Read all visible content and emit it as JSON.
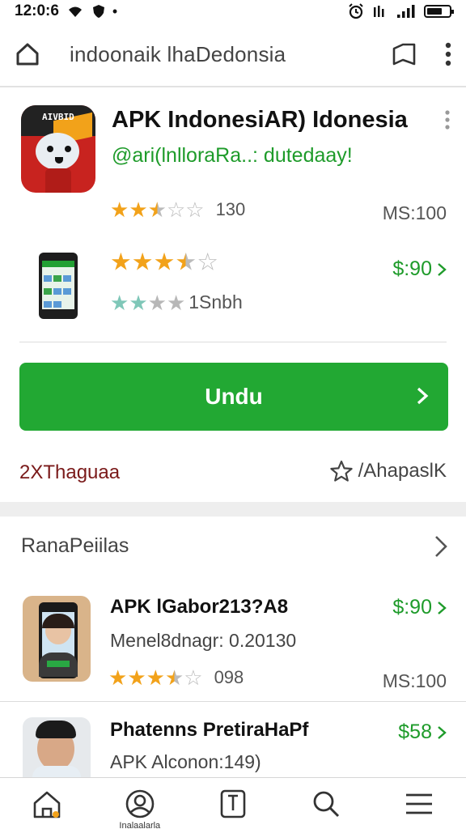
{
  "status_bar": {
    "time": "12:0:6",
    "dot": "•"
  },
  "browser": {
    "url": "indoonaik lhaDedonsia",
    "icons": [
      "home-icon",
      "share-icon",
      "more-vert-icon"
    ]
  },
  "app_card": {
    "title": "APK IndonesiAR) Idonesia",
    "subtitle": "@ari(lnlloraRa..: dutedaay!",
    "icon_cap_text": "AIVBID",
    "rating_1": {
      "rating": 2.5,
      "max": 5,
      "count": "130",
      "price": "MS:100"
    },
    "rating_2": {
      "rating": 3.5,
      "max": 5,
      "price": "$:90"
    },
    "rating_3": {
      "rating": 2,
      "max": 4,
      "count": "1Snbh"
    },
    "download_label": "Undu",
    "footer_left": "2XThaguaa",
    "footer_right": "/AhapaslK",
    "colors": {
      "accent": "#22a833",
      "price_green": "#1e9b2a",
      "star": "#f2a21a"
    }
  },
  "related": {
    "header": "RanaPeiilas",
    "items": [
      {
        "title": "APK lGabor213?A8",
        "subtitle": "Menel8dnagr: 0.20130",
        "price": "$:90",
        "rating": 3.5,
        "max": 5,
        "count": "098",
        "price_right": "MS:100"
      },
      {
        "title": "Phatenns PretiraHaPf",
        "subtitle": "APK Alconon:149)",
        "price": "$58"
      }
    ]
  },
  "bottom_nav": {
    "items": [
      "home-icon",
      "account-icon",
      "bookmark-icon",
      "search-icon",
      "menu-icon"
    ],
    "label_2": "Inalaalarla"
  }
}
